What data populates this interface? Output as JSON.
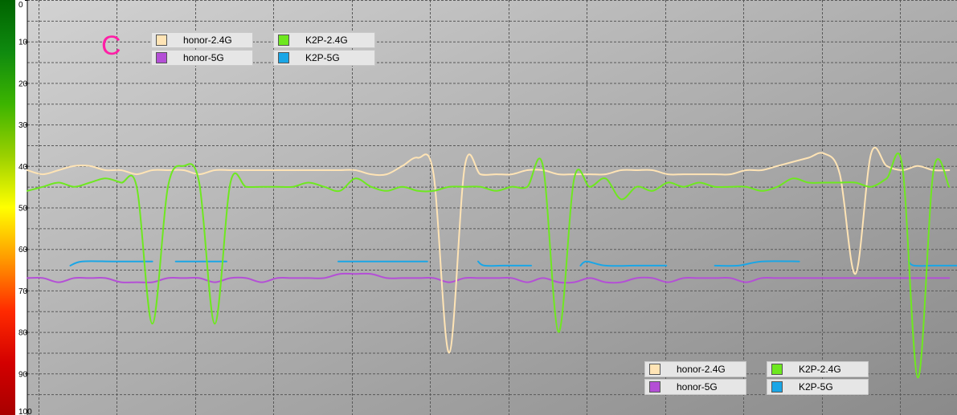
{
  "corner_mark": "C",
  "chart_data": {
    "type": "line",
    "xlabel": "",
    "ylabel": "",
    "ylim": [
      0,
      100
    ],
    "y_inverted": true,
    "yticks": [
      "0",
      "10",
      "20",
      "30",
      "40",
      "50",
      "60",
      "70",
      "80",
      "90",
      "100"
    ],
    "grid": true,
    "background_gradient": [
      "#d2d2d2",
      "#8a8a8a"
    ],
    "colorbar": [
      "#006400",
      "#0f8a0f",
      "#3cb400",
      "#9ad000",
      "#ffff00",
      "#ff9900",
      "#ff2a00",
      "#d30000",
      "#a80000"
    ],
    "legend_position": "top-left and bottom-right (drawn twice)",
    "x": [
      0,
      20,
      40,
      60,
      80,
      100,
      120,
      140,
      160,
      180,
      200,
      220,
      240,
      260,
      280,
      300,
      320,
      340,
      360,
      380,
      400,
      420,
      440,
      460,
      480,
      500,
      520,
      540,
      560,
      580,
      600,
      620,
      640,
      660,
      680,
      700,
      720,
      740,
      760,
      780,
      800,
      820,
      840,
      860,
      880,
      900,
      920,
      940,
      960,
      980,
      1000,
      1020,
      1040,
      1060,
      1080,
      1100,
      1120,
      1140,
      1160,
      1180
    ],
    "series": [
      {
        "name": "honor-2.4G",
        "color": "#ffe4b5",
        "values": [
          41,
          42,
          41,
          40,
          40,
          41,
          41,
          42,
          41,
          41,
          41,
          42,
          41,
          41,
          41,
          41,
          41,
          41,
          41,
          41,
          41,
          41,
          42,
          42,
          40,
          38,
          42,
          85,
          40,
          42,
          42,
          42,
          41,
          41,
          42,
          42,
          42,
          42,
          41,
          41,
          41,
          42,
          42,
          42,
          42,
          42,
          41,
          41,
          40,
          39,
          38,
          37,
          42,
          66,
          37,
          40,
          41,
          40,
          41,
          41
        ]
      },
      {
        "name": "honor-5G",
        "color": "#b44fd6",
        "values": [
          67,
          67,
          68,
          67,
          67,
          67,
          68,
          68,
          68,
          67,
          67,
          67,
          68,
          67,
          67,
          68,
          67,
          67,
          67,
          67,
          66,
          66,
          66,
          67,
          67,
          67,
          67,
          68,
          67,
          67,
          67,
          67,
          68,
          67,
          68,
          68,
          67,
          68,
          68,
          67,
          67,
          68,
          67,
          67,
          67,
          67,
          68,
          67,
          67,
          67,
          67,
          67,
          67,
          67,
          67,
          67,
          67,
          67,
          67,
          67
        ]
      },
      {
        "name": "K2P-2.4G",
        "color": "#6ee81f",
        "values": [
          46,
          45,
          44,
          45,
          44,
          43,
          44,
          45,
          78,
          45,
          40,
          44,
          78,
          44,
          45,
          45,
          45,
          45,
          44,
          45,
          46,
          43,
          45,
          46,
          45,
          46,
          46,
          45,
          45,
          45,
          46,
          45,
          45,
          40,
          80,
          43,
          45,
          43,
          48,
          45,
          46,
          44,
          45,
          44,
          45,
          45,
          45,
          46,
          45,
          43,
          44,
          44,
          44,
          44,
          45,
          43,
          40,
          91,
          41,
          45
        ]
      },
      {
        "name": "K2P-5G",
        "color": "#1aa6e6",
        "segments": [
          {
            "x": [
              55,
              70,
              110,
              160
            ],
            "values": [
              64,
              63,
              63,
              63
            ]
          },
          {
            "x": [
              190,
              220,
              255
            ],
            "values": [
              63,
              63,
              63
            ]
          },
          {
            "x": [
              398,
              430,
              470,
              512
            ],
            "values": [
              63,
              63,
              63,
              63
            ]
          },
          {
            "x": [
              577,
              585,
              610,
              645
            ],
            "values": [
              63,
              64,
              64,
              64
            ]
          },
          {
            "x": [
              708,
              716,
              740,
              780,
              818
            ],
            "values": [
              64,
              63,
              64,
              64,
              64
            ]
          },
          {
            "x": [
              880,
              910,
              940,
              988
            ],
            "values": [
              64,
              64,
              63,
              63
            ]
          },
          {
            "x": [
              1128,
              1135,
              1160,
              1190
            ],
            "values": [
              63,
              64,
              64,
              64
            ]
          }
        ]
      }
    ]
  }
}
